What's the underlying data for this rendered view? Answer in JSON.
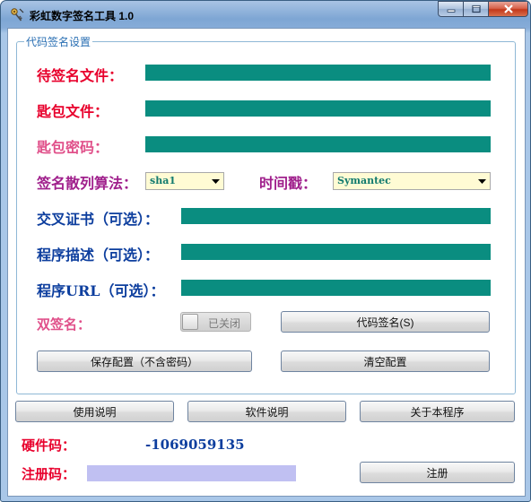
{
  "window": {
    "title": "彩虹数字签名工具 1.0",
    "buttons": {
      "minimize": "minimize",
      "maximize": "maximize",
      "close": "close"
    }
  },
  "colors": {
    "field_fill": "#0a8d80",
    "select_fill": "#fffbd4",
    "register_input_fill": "#c0c0f2",
    "label_red": "#e8002c",
    "label_pink": "#e0508a",
    "label_purple": "#a0208c",
    "label_navy": "#0d3e9e"
  },
  "group": {
    "title": "代码签名设置",
    "file_label": "待签名文件：",
    "file_value": "",
    "cert_label": "匙包文件：",
    "cert_value": "",
    "password_label": "匙包密码：",
    "password_value": "",
    "hash_label": "签名散列算法：",
    "hash_value": "sha1",
    "timestamp_label": "时间戳：",
    "timestamp_value": "Symantec",
    "cross_cert_label": "交叉证书（可选）：",
    "cross_cert_value": "",
    "desc_label": "程序描述（可选）：",
    "desc_value": "",
    "url_label": "程序URL（可选）：",
    "url_value": "",
    "dual_label": "双签名：",
    "dual_toggle": "已关闭",
    "sign_button": "代码签名(S)",
    "save_button": "保存配置（不含密码）",
    "clear_button": "清空配置"
  },
  "footer": {
    "usage_button": "使用说明",
    "software_button": "软件说明",
    "about_button": "关于本程序",
    "hardware_label": "硬件码：",
    "hardware_value": "-1069059135",
    "reg_label": "注册码：",
    "reg_value": "",
    "register_button": "注册"
  },
  "icons": {
    "app": "app-key-icon",
    "select_arrow": "chevron-down-icon"
  }
}
